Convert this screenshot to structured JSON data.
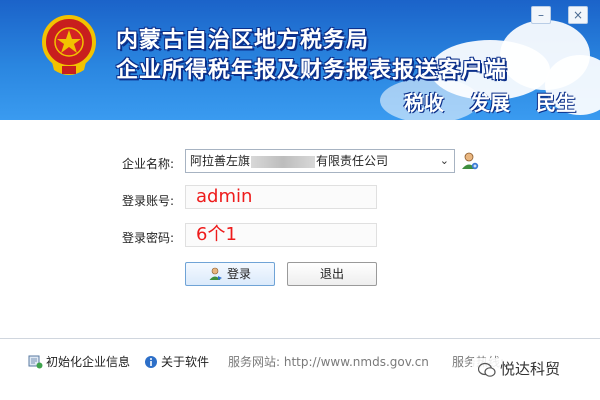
{
  "banner": {
    "title_line1": "内蒙古自治区地方税务局",
    "title_line2": "企业所得税年报及财务报表报送客户端",
    "motto": [
      "税收",
      "发展",
      "民生"
    ],
    "minimize_label": "–",
    "close_label": "×"
  },
  "form": {
    "company_label": "企业名称:",
    "company_value_prefix": "阿拉善左旗",
    "company_value_suffix": "有限责任公司",
    "account_label": "登录账号:",
    "account_value": "admin",
    "password_label": "登录密码:",
    "password_value": "6个1",
    "login_button": "登录",
    "exit_button": "退出"
  },
  "footer": {
    "init_label": "初始化企业信息",
    "about_label": "关于软件",
    "service_site": "服务网站: http://www.nmds.gov.cn",
    "hotline": "服务热线:"
  },
  "watermark": "悦达科贸",
  "colors": {
    "banner_top": "#1b63c9",
    "banner_bottom": "#3a9bf0",
    "title_outline": "#0b2f8a",
    "input_text": "#ee1b1b"
  }
}
